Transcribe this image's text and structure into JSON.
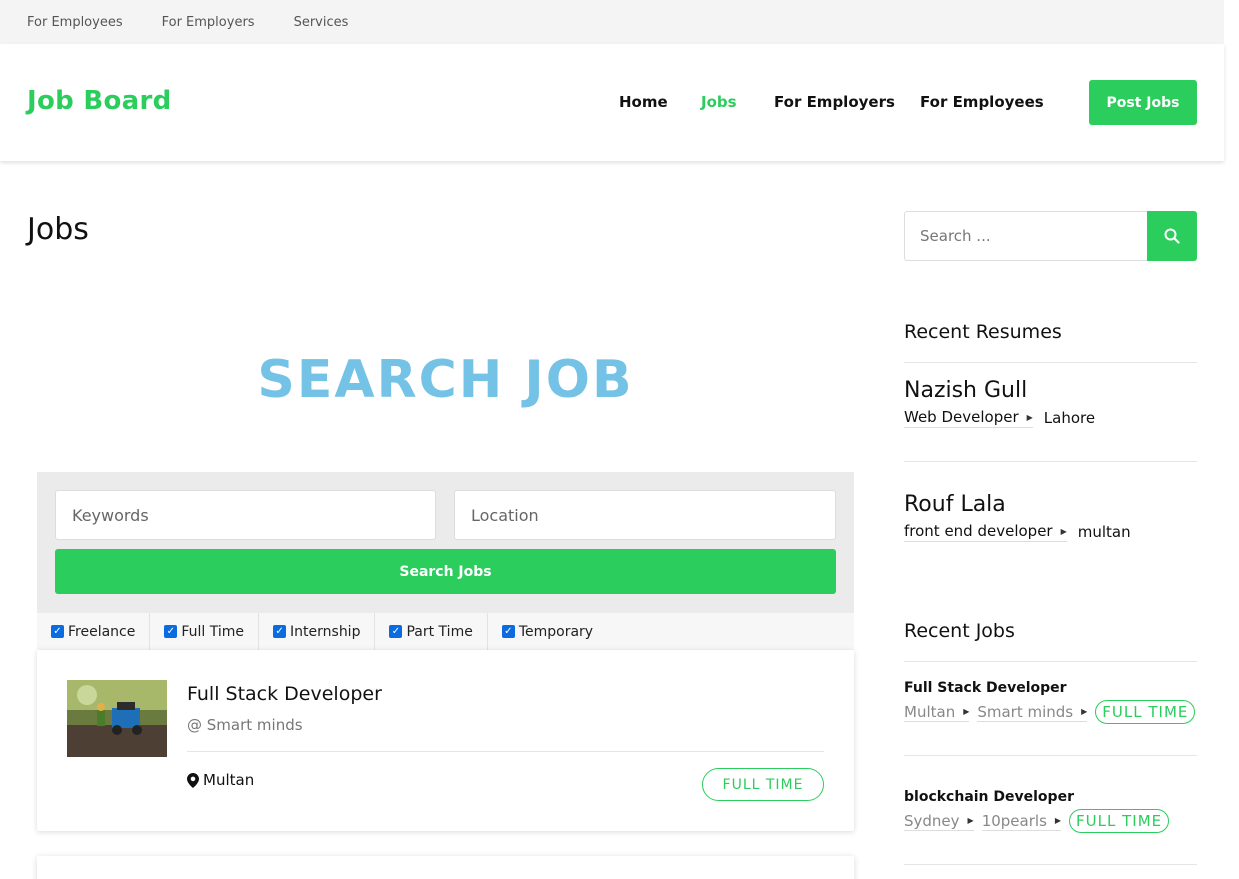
{
  "topbar": {
    "links": [
      "For Employees",
      "For Employers",
      "Services"
    ]
  },
  "header": {
    "logo": "Job Board",
    "nav": [
      "Home",
      "Jobs",
      "For Employers",
      "For Employees"
    ],
    "active_nav": "Jobs",
    "post_button": "Post Jobs"
  },
  "colors": {
    "accent": "#2bcd5d",
    "banner": "#74c2e5"
  },
  "main": {
    "title": "Jobs",
    "banner_text": "SEARCH JOB",
    "search": {
      "keywords_placeholder": "Keywords",
      "location_placeholder": "Location",
      "button": "Search Jobs"
    },
    "filters": [
      {
        "label": "Freelance",
        "checked": true
      },
      {
        "label": "Full Time",
        "checked": true
      },
      {
        "label": "Internship",
        "checked": true
      },
      {
        "label": "Part Time",
        "checked": true
      },
      {
        "label": "Temporary",
        "checked": true
      }
    ],
    "job": {
      "title": "Full Stack Developer",
      "company": "@ Smart minds",
      "location": "Multan",
      "type": "FULL TIME"
    }
  },
  "sidebar": {
    "search_placeholder": "Search ...",
    "recent_resumes_heading": "Recent Resumes",
    "resumes": [
      {
        "name": "Nazish Gull",
        "role": "Web Developer",
        "location": "Lahore"
      },
      {
        "name": "Rouf Lala",
        "role": "front end developer",
        "location": "multan"
      }
    ],
    "recent_jobs_heading": "Recent Jobs",
    "jobs": [
      {
        "title": "Full Stack Developer",
        "location": "Multan",
        "company": "Smart minds",
        "type": "FULL TIME"
      },
      {
        "title": "blockchain Developer",
        "location": "Sydney",
        "company": "10pearls",
        "type": "FULL TIME"
      }
    ]
  }
}
